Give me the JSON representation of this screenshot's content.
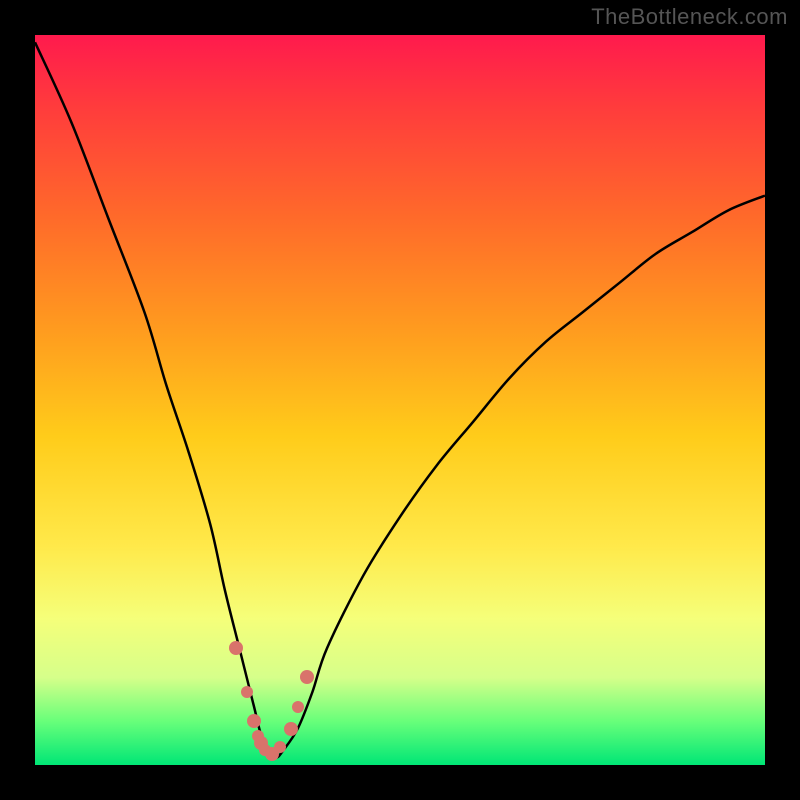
{
  "watermark": "TheBottleneck.com",
  "chart_data": {
    "type": "line",
    "title": "",
    "xlabel": "",
    "ylabel": "",
    "xlim": [
      0,
      100
    ],
    "ylim": [
      0,
      100
    ],
    "series": [
      {
        "name": "bottleneck-curve",
        "x": [
          0,
          5,
          10,
          15,
          18,
          21,
          24,
          26,
          28,
          30,
          31,
          32,
          33,
          34,
          36,
          38,
          40,
          45,
          50,
          55,
          60,
          65,
          70,
          75,
          80,
          85,
          90,
          95,
          100
        ],
        "values": [
          99,
          88,
          75,
          62,
          52,
          43,
          33,
          24,
          16,
          8,
          4,
          2,
          1,
          2,
          5,
          10,
          16,
          26,
          34,
          41,
          47,
          53,
          58,
          62,
          66,
          70,
          73,
          76,
          78
        ]
      }
    ],
    "markers": [
      {
        "x": 27.5,
        "y": 16
      },
      {
        "x": 29.0,
        "y": 10
      },
      {
        "x": 30.0,
        "y": 6
      },
      {
        "x": 30.5,
        "y": 4
      },
      {
        "x": 31.0,
        "y": 3
      },
      {
        "x": 31.5,
        "y": 2
      },
      {
        "x": 32.5,
        "y": 1.5
      },
      {
        "x": 33.5,
        "y": 2.5
      },
      {
        "x": 35.0,
        "y": 5
      },
      {
        "x": 36.0,
        "y": 8
      },
      {
        "x": 37.3,
        "y": 12
      }
    ]
  }
}
